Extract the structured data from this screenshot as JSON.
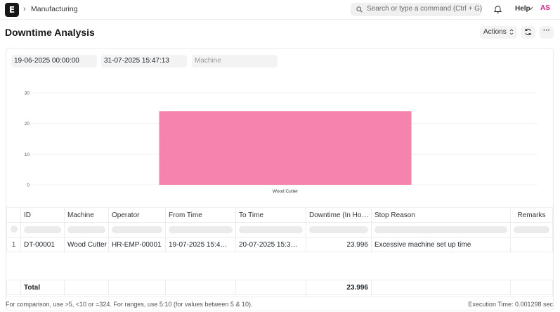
{
  "app": {
    "logo_letter": "E",
    "breadcrumb_sep": "›"
  },
  "breadcrumb": {
    "module": "Manufacturing"
  },
  "search": {
    "placeholder": "Search or type a command (Ctrl + G)"
  },
  "navbar": {
    "help_label": "Help",
    "avatar_initials": "AS"
  },
  "page": {
    "title": "Downtime Analysis",
    "actions_label": "Actions",
    "more_label": "···"
  },
  "filters": {
    "from_date": "19-06-2025 00:00:00",
    "to_date": "31-07-2025 15:47:13",
    "machine_placeholder": "Machine"
  },
  "chart_data": {
    "type": "bar",
    "categories": [
      "Wood Cutter"
    ],
    "values": [
      23.996
    ],
    "ylim": [
      0,
      30
    ],
    "yticks": [
      0,
      10,
      20,
      30
    ],
    "grid": true,
    "color": "#f683ae"
  },
  "table": {
    "columns": [
      "ID",
      "Machine",
      "Operator",
      "From Time",
      "To Time",
      "Downtime (In Ho…",
      "Stop Reason",
      "Remarks"
    ],
    "rows": [
      {
        "index": "1",
        "id": "DT-00001",
        "machine": "Wood Cutter",
        "operator": "HR-EMP-00001",
        "from_time": "19-07-2025 15:4…",
        "to_time": "20-07-2025 15:3…",
        "downtime": "23.996",
        "stop_reason": "Excessive machine set up time",
        "remarks": ""
      }
    ],
    "total_label": "Total",
    "total_downtime": "23.996"
  },
  "footer": {
    "hint": "For comparison, use >5, <10 or =324. For ranges, use 5:10 (for values between 5 & 10).",
    "execution_time": "Execution Time: 0.001298 sec"
  }
}
